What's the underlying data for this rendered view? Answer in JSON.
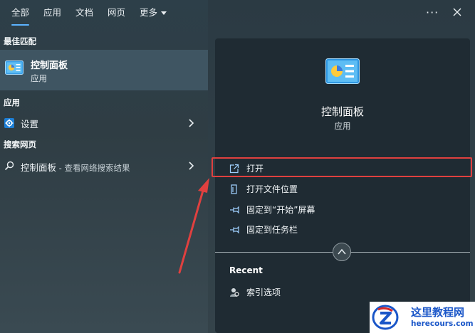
{
  "tabs": [
    {
      "label": "全部",
      "active": true
    },
    {
      "label": "应用"
    },
    {
      "label": "文档"
    },
    {
      "label": "网页"
    },
    {
      "label": "更多"
    }
  ],
  "header": {
    "more_icon": "ellipsis-icon",
    "close_icon": "close-icon"
  },
  "best_match": {
    "section_title": "最佳匹配",
    "name": "控制面板",
    "type": "应用",
    "icon": "control-panel-icon"
  },
  "apps": {
    "section_title": "应用",
    "items": [
      {
        "label": "设置",
        "icon": "settings-gear-icon"
      }
    ]
  },
  "web": {
    "section_title": "搜索网页",
    "query": "控制面板",
    "suffix": " - 查看网络搜索结果"
  },
  "detail": {
    "title": "控制面板",
    "subtitle": "应用",
    "actions": [
      {
        "label": "打开",
        "icon": "open-icon",
        "highlighted": true
      },
      {
        "label": "打开文件位置",
        "icon": "file-location-icon"
      },
      {
        "label": "固定到“开始”屏幕",
        "icon": "pin-icon"
      },
      {
        "label": "固定到任务栏",
        "icon": "pin-icon"
      }
    ],
    "recent_title": "Recent",
    "recent_items": [
      {
        "label": "索引选项",
        "icon": "indexing-options-icon"
      }
    ]
  },
  "watermark": {
    "text": "这里教程网",
    "url": "herecours.com"
  },
  "colors": {
    "highlight": "#e0403f",
    "accent": "#5cb3ff",
    "watermark": "#1a56c8"
  }
}
